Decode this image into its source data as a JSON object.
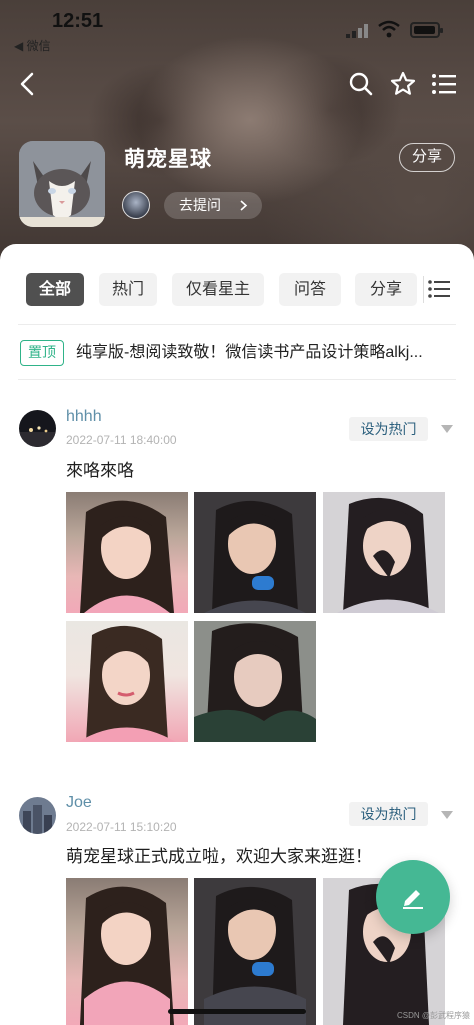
{
  "status_bar": {
    "time": "12:51",
    "back_app": "◀ 微信"
  },
  "group": {
    "name": "萌宠星球",
    "share_label": "分享",
    "ask_label": "去提问"
  },
  "filters": [
    {
      "label": "全部",
      "active": true
    },
    {
      "label": "热门",
      "active": false
    },
    {
      "label": "仅看星主",
      "active": false
    },
    {
      "label": "问答",
      "active": false
    },
    {
      "label": "分享",
      "active": false
    }
  ],
  "pinned": {
    "badge": "置顶",
    "text": "纯享版-想阅读致敬！微信读书产品设计策略alkj..."
  },
  "posts": [
    {
      "author": "hhhh",
      "time": "2022-07-11 18:40:00",
      "action": "设为热门",
      "text": "來咯來咯"
    },
    {
      "author": "Joe",
      "time": "2022-07-11 15:10:20",
      "action": "设为热门",
      "text": "萌宠星球正式成立啦，欢迎大家来逛逛！"
    }
  ],
  "watermark": "CSDN @彭武程序猿",
  "colors": {
    "accent": "#45b894",
    "pin_green": "#2fb389",
    "author_blue": "#5f8fa8",
    "active_filter": "#505050"
  },
  "icons": [
    "back-icon",
    "search-icon",
    "star-icon",
    "menu-icon",
    "chevron-right-icon",
    "list-icon",
    "dropdown-arrow-icon",
    "edit-icon"
  ]
}
